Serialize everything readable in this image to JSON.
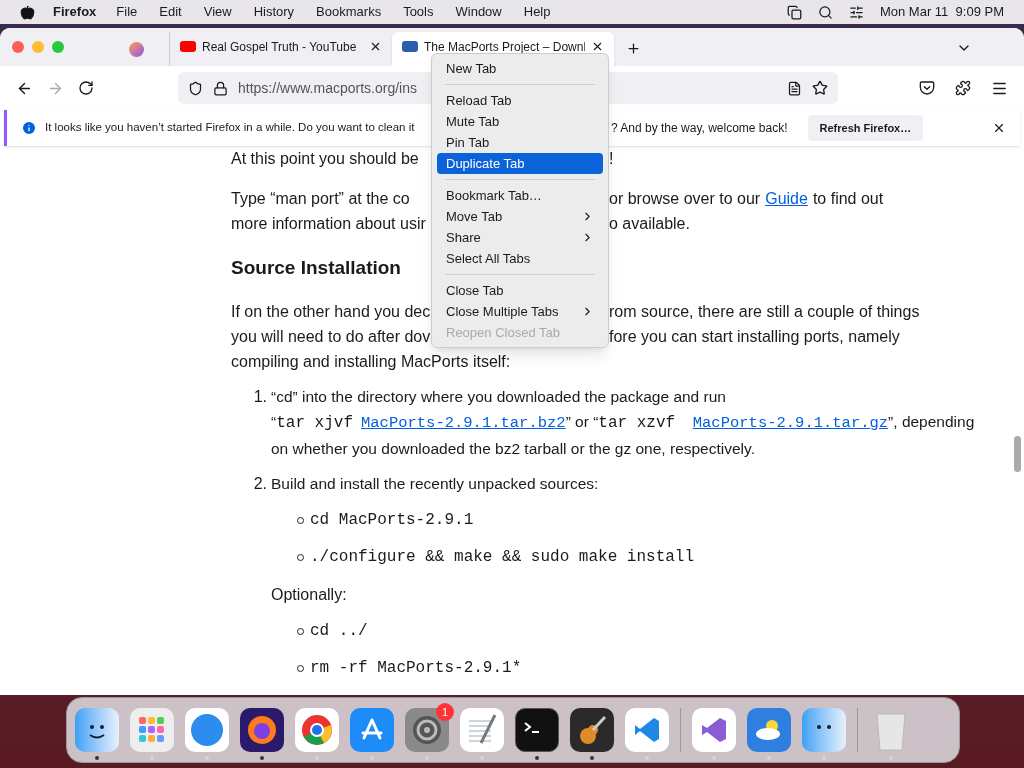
{
  "menu_bar": {
    "app": "Firefox",
    "items": [
      "File",
      "Edit",
      "View",
      "History",
      "Bookmarks",
      "Tools",
      "Window",
      "Help"
    ],
    "clock": "Mon Mar 11  9:09 PM"
  },
  "tabs": [
    {
      "kind": "pinned",
      "selected": false
    },
    {
      "kind": "tab",
      "title": "Real Gospel Truth - YouTube",
      "selected": false
    },
    {
      "kind": "tab",
      "title": "The MacPorts Project – Downl",
      "selected": true
    }
  ],
  "url": "https://www.macports.org/ins",
  "notification": {
    "left": "It looks like you haven’t started Firefox in a while. Do you want to clean it",
    "right": "? And by the way, welcome back!",
    "button": "Refresh Firefox…"
  },
  "context_menu": [
    {
      "kind": "item",
      "label": "New Tab",
      "submenu": false,
      "disabled": false,
      "selected": false
    },
    {
      "kind": "separator"
    },
    {
      "kind": "item",
      "label": "Reload Tab",
      "submenu": false,
      "disabled": false,
      "selected": false
    },
    {
      "kind": "item",
      "label": "Mute Tab",
      "submenu": false,
      "disabled": false,
      "selected": false
    },
    {
      "kind": "item",
      "label": "Pin Tab",
      "submenu": false,
      "disabled": false,
      "selected": false
    },
    {
      "kind": "item",
      "label": "Duplicate Tab",
      "submenu": false,
      "disabled": false,
      "selected": true
    },
    {
      "kind": "separator"
    },
    {
      "kind": "item",
      "label": "Bookmark Tab…",
      "submenu": false,
      "disabled": false,
      "selected": false
    },
    {
      "kind": "item",
      "label": "Move Tab",
      "submenu": true,
      "disabled": false,
      "selected": false
    },
    {
      "kind": "item",
      "label": "Share",
      "submenu": true,
      "disabled": false,
      "selected": false
    },
    {
      "kind": "item",
      "label": "Select All Tabs",
      "submenu": false,
      "disabled": false,
      "selected": false
    },
    {
      "kind": "separator"
    },
    {
      "kind": "item",
      "label": "Close Tab",
      "submenu": false,
      "disabled": false,
      "selected": false
    },
    {
      "kind": "item",
      "label": "Close Multiple Tabs",
      "submenu": true,
      "disabled": false,
      "selected": false
    },
    {
      "kind": "item",
      "label": "Reopen Closed Tab",
      "submenu": false,
      "disabled": true,
      "selected": false
    }
  ],
  "page": {
    "lines_top": [
      {
        "left": "At this point you should be",
        "right": "!"
      },
      {
        "left": "Type “man port” at the co",
        "right": "or browse over to our",
        "link": "Guide",
        "after": "to find out"
      },
      {
        "left": "more information about usir",
        "right": "o available."
      }
    ],
    "heading": "Source Installation",
    "lines_mid": [
      {
        "left": "If on the other hand you dec",
        "right": "rom source, there are still a couple of things"
      },
      {
        "left": "you will need to do after dov",
        "right": "fore you can start installing ports, namely"
      }
    ],
    "compiling": "compiling and installing MacPorts itself:",
    "steps": [
      {
        "num": "1.",
        "parts": [
          {
            "kind": "text",
            "text": "“cd” into the directory where you downloaded the package and run “"
          },
          {
            "kind": "code",
            "text": "tar xjvf"
          },
          {
            "kind": "link",
            "text": "MacPorts-2.9.1.tar.bz2"
          },
          {
            "kind": "text",
            "text": "” or “"
          },
          {
            "kind": "code",
            "text": "tar xzvf "
          },
          {
            "kind": "link",
            "text": "MacPorts-2.9.1.tar.gz"
          },
          {
            "kind": "text",
            "text": "”, depending on whether you downloaded the bz2 tarball or the gz one, respectively."
          }
        ]
      },
      {
        "num": "2.",
        "parts": [
          {
            "kind": "text",
            "text": "Build and install the recently unpacked sources:"
          }
        ],
        "commands": [
          "cd MacPorts-2.9.1",
          "./configure && make && sudo make install"
        ],
        "note": "Optionally:",
        "commands_optional": [
          "cd ../",
          "rm -rf MacPorts-2.9.1*"
        ]
      }
    ]
  },
  "dock": [
    {
      "running": true
    },
    {
      "running": false
    },
    {
      "running": false
    },
    {
      "running": true
    },
    {
      "running": false
    },
    {
      "running": false
    },
    {
      "running": false,
      "badge": "1"
    },
    {
      "running": false
    },
    {
      "running": true
    },
    {
      "running": true
    },
    {
      "running": false
    },
    {
      "running": false
    },
    {
      "running": false
    },
    {
      "running": false
    },
    {
      "running": false
    }
  ]
}
